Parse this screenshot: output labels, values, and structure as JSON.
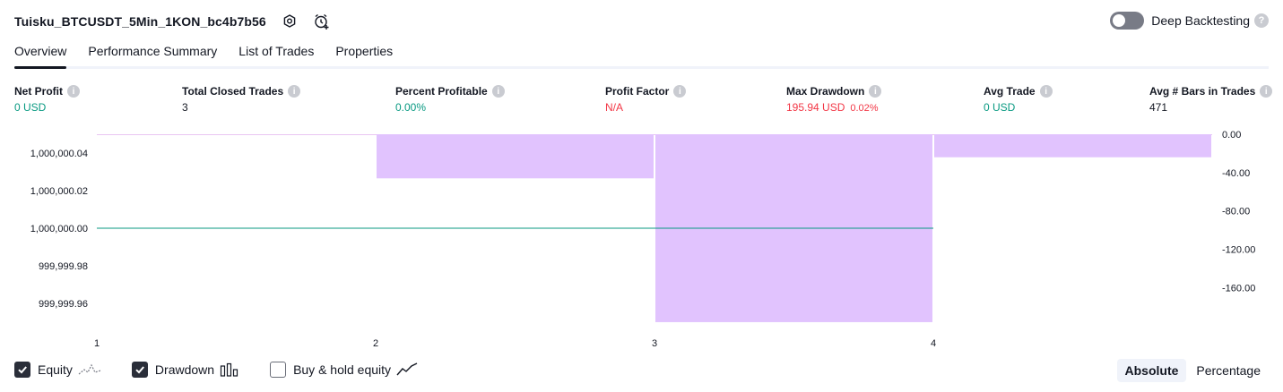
{
  "header": {
    "strategy_name": "Tuisku_BTCUSDT_5Min_1KON_bc4b7b56",
    "deep_backtesting_label": "Deep Backtesting",
    "deep_backtesting_on": false,
    "help_glyph": "?"
  },
  "tabs": [
    {
      "label": "Overview",
      "active": true
    },
    {
      "label": "Performance Summary",
      "active": false
    },
    {
      "label": "List of Trades",
      "active": false
    },
    {
      "label": "Properties",
      "active": false
    }
  ],
  "metrics": {
    "net_profit": {
      "label": "Net Profit",
      "value": "0 USD",
      "info": "i"
    },
    "total_closed_trades": {
      "label": "Total Closed Trades",
      "value": "3",
      "info": "i"
    },
    "percent_profitable": {
      "label": "Percent Profitable",
      "value": "0.00%",
      "info": "i"
    },
    "profit_factor": {
      "label": "Profit Factor",
      "value": "N/A",
      "info": "i"
    },
    "max_drawdown": {
      "label": "Max Drawdown",
      "value": "195.94 USD",
      "pct": "0.02%",
      "info": "i"
    },
    "avg_trade": {
      "label": "Avg Trade",
      "value": "0 USD",
      "info": "i"
    },
    "avg_bars": {
      "label": "Avg # Bars in Trades",
      "value": "471",
      "info": "i"
    }
  },
  "chart_data": {
    "type": "bar",
    "x": [
      1,
      2,
      3,
      4
    ],
    "x_tick_labels": [
      "1",
      "2",
      "3",
      "4"
    ],
    "equity_line": {
      "x": [
        1,
        4
      ],
      "y": [
        1000000.0,
        1000000.0
      ],
      "color": "#089981"
    },
    "drawdown_bars": {
      "categories": [
        1,
        2,
        3,
        4
      ],
      "values": [
        0,
        -46,
        -195.94,
        -24
      ],
      "color": "#e1c3fe"
    },
    "left_axis": {
      "ticks": [
        "1,000,000.04",
        "1,000,000.02",
        "1,000,000.00",
        "999,999.98",
        "999,999.96"
      ],
      "ylim": [
        999999.95,
        1000000.05
      ]
    },
    "right_axis": {
      "ticks": [
        "0.00",
        "-40.00",
        "-80.00",
        "-120.00",
        "-160.00"
      ],
      "ylim": [
        -196,
        0
      ]
    }
  },
  "legend": {
    "equity": {
      "label": "Equity",
      "checked": true
    },
    "drawdown": {
      "label": "Drawdown",
      "checked": true
    },
    "buy_hold": {
      "label": "Buy & hold equity",
      "checked": false
    }
  },
  "mode": {
    "absolute": "Absolute",
    "percentage": "Percentage",
    "selected": "absolute"
  },
  "colors": {
    "accent": "#131722",
    "positive": "#089981",
    "negative": "#f23645",
    "drawdown": "#e1c3fe"
  }
}
